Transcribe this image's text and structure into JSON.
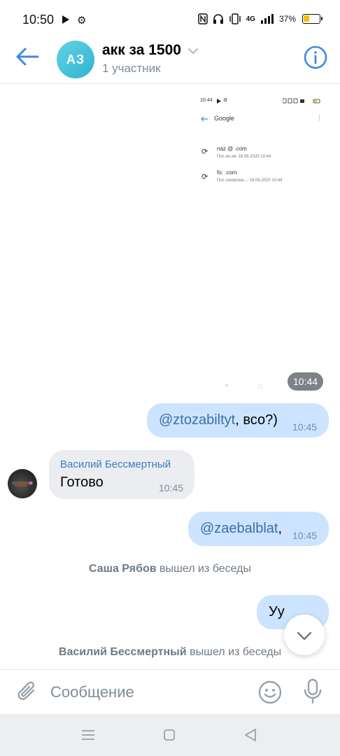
{
  "status_bar": {
    "time": "10:50",
    "network": "4G",
    "battery_percent": "37%",
    "battery_level": 0.37,
    "icons": [
      "play-icon",
      "gear-icon",
      "nfc-icon",
      "headset-icon",
      "vibrate-icon",
      "signal-icon",
      "battery-icon"
    ]
  },
  "header": {
    "avatar_initials": "АЗ",
    "title": "акк за 1500",
    "subtitle": "1 участник",
    "accent_color": "#3f8ae0"
  },
  "screenshot": {
    "time": "10:44",
    "title": "Google",
    "accounts": [
      {
        "email": "naz              @        .com",
        "status": "Пос        ин    ия: 18.08.2020 10:44"
      },
      {
        "email": "fo:              .com",
        "status": "Пос    синхрони...: 18.08.2020 10:44"
      }
    ]
  },
  "time_chip": "10:44",
  "messages": [
    {
      "type": "out",
      "mention": "@ztozabiltyt",
      "text": ", всо?)",
      "time": "10:45"
    },
    {
      "type": "in",
      "sender": "Василий Бессмертный",
      "text": "Готово",
      "time": "10:45"
    },
    {
      "type": "out",
      "mention": "@zaebalblat",
      "text": ",",
      "time": "10:45"
    },
    {
      "type": "system",
      "actor": "Саша Рябов",
      "text": " вышел из беседы"
    },
    {
      "type": "out",
      "mention": "",
      "text": "Уу",
      "time": ""
    },
    {
      "type": "system",
      "actor": "Василий Бессмертный",
      "text": " вышел из беседы"
    }
  ],
  "composer": {
    "placeholder": "Сообщение"
  },
  "colors": {
    "outgoing_bubble": "#cce4ff",
    "incoming_bubble": "#ebedf0",
    "link": "#3f7bc1",
    "meta_text": "#818c99"
  }
}
